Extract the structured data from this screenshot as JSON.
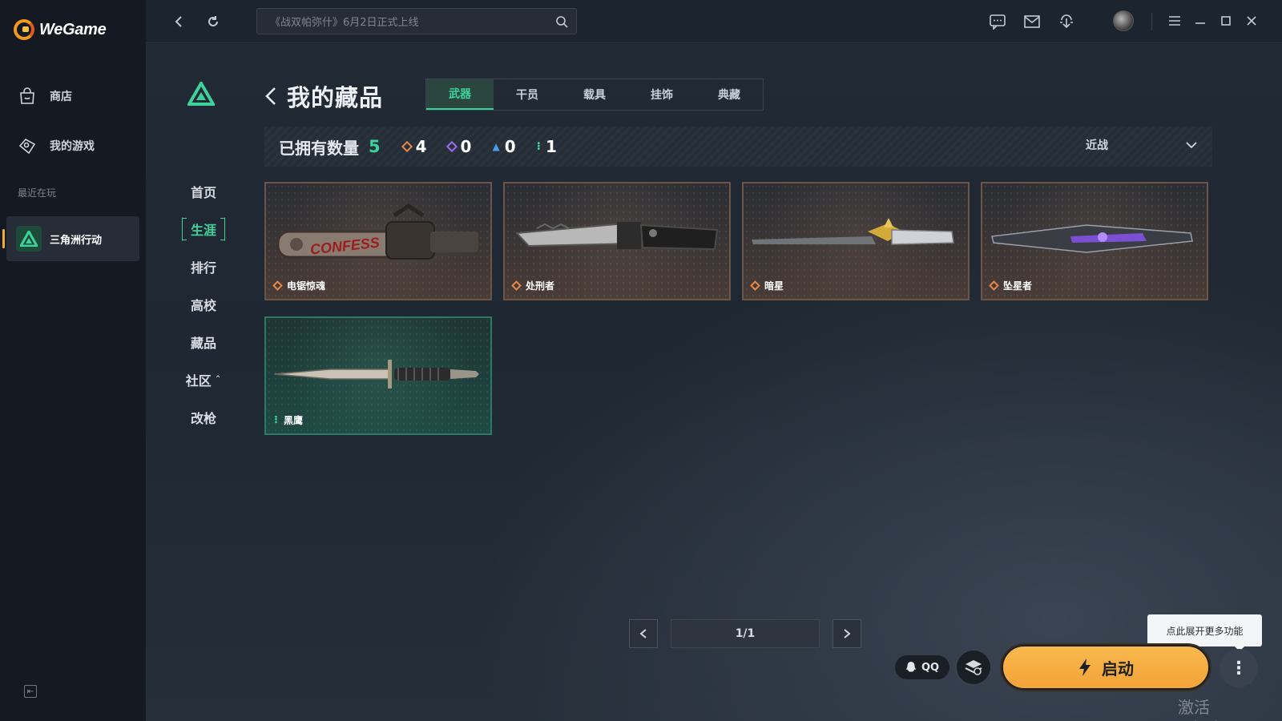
{
  "app": {
    "brand": "WeGame"
  },
  "sidebar": {
    "items": [
      {
        "label": "商店",
        "icon": "store-bag-icon"
      },
      {
        "label": "我的游戏",
        "icon": "my-games-icon"
      }
    ],
    "recent_label": "最近在玩",
    "recent_game": "三角洲行动"
  },
  "topbar": {
    "search_placeholder": "《战双帕弥什》6月2日正式上线"
  },
  "game_nav": {
    "items": [
      "首页",
      "生涯",
      "排行",
      "高校",
      "藏品",
      "社区",
      "改枪"
    ],
    "active": "生涯"
  },
  "collection": {
    "title": "我的藏品",
    "tabs": [
      "武器",
      "干员",
      "载具",
      "挂饰",
      "典藏"
    ],
    "active_tab": "武器",
    "owned_label": "已拥有数量",
    "owned_count": "5",
    "rarity_counts": [
      {
        "color": "#e3884a",
        "count": "4"
      },
      {
        "color": "#9b6cf2",
        "count": "0"
      },
      {
        "color": "#4a9be8",
        "count": "0"
      },
      {
        "color": "#3ed29b",
        "count": "1"
      }
    ],
    "filter": "近战",
    "items": [
      {
        "name": "电锯惊魂",
        "rarity": "orange"
      },
      {
        "name": "处刑者",
        "rarity": "orange"
      },
      {
        "name": "暗星",
        "rarity": "orange"
      },
      {
        "name": "坠星者",
        "rarity": "orange"
      },
      {
        "name": "黑鹰",
        "rarity": "green"
      }
    ]
  },
  "pager": {
    "display": "1/1"
  },
  "tooltip": "点此展开更多功能",
  "qq_label": "QQ",
  "launch_label": "启动",
  "watermark": "激活 Windows",
  "colors": {
    "accent": "#3ed29b",
    "launch": "#f7b040",
    "rarity_orange": "#e3884a"
  }
}
